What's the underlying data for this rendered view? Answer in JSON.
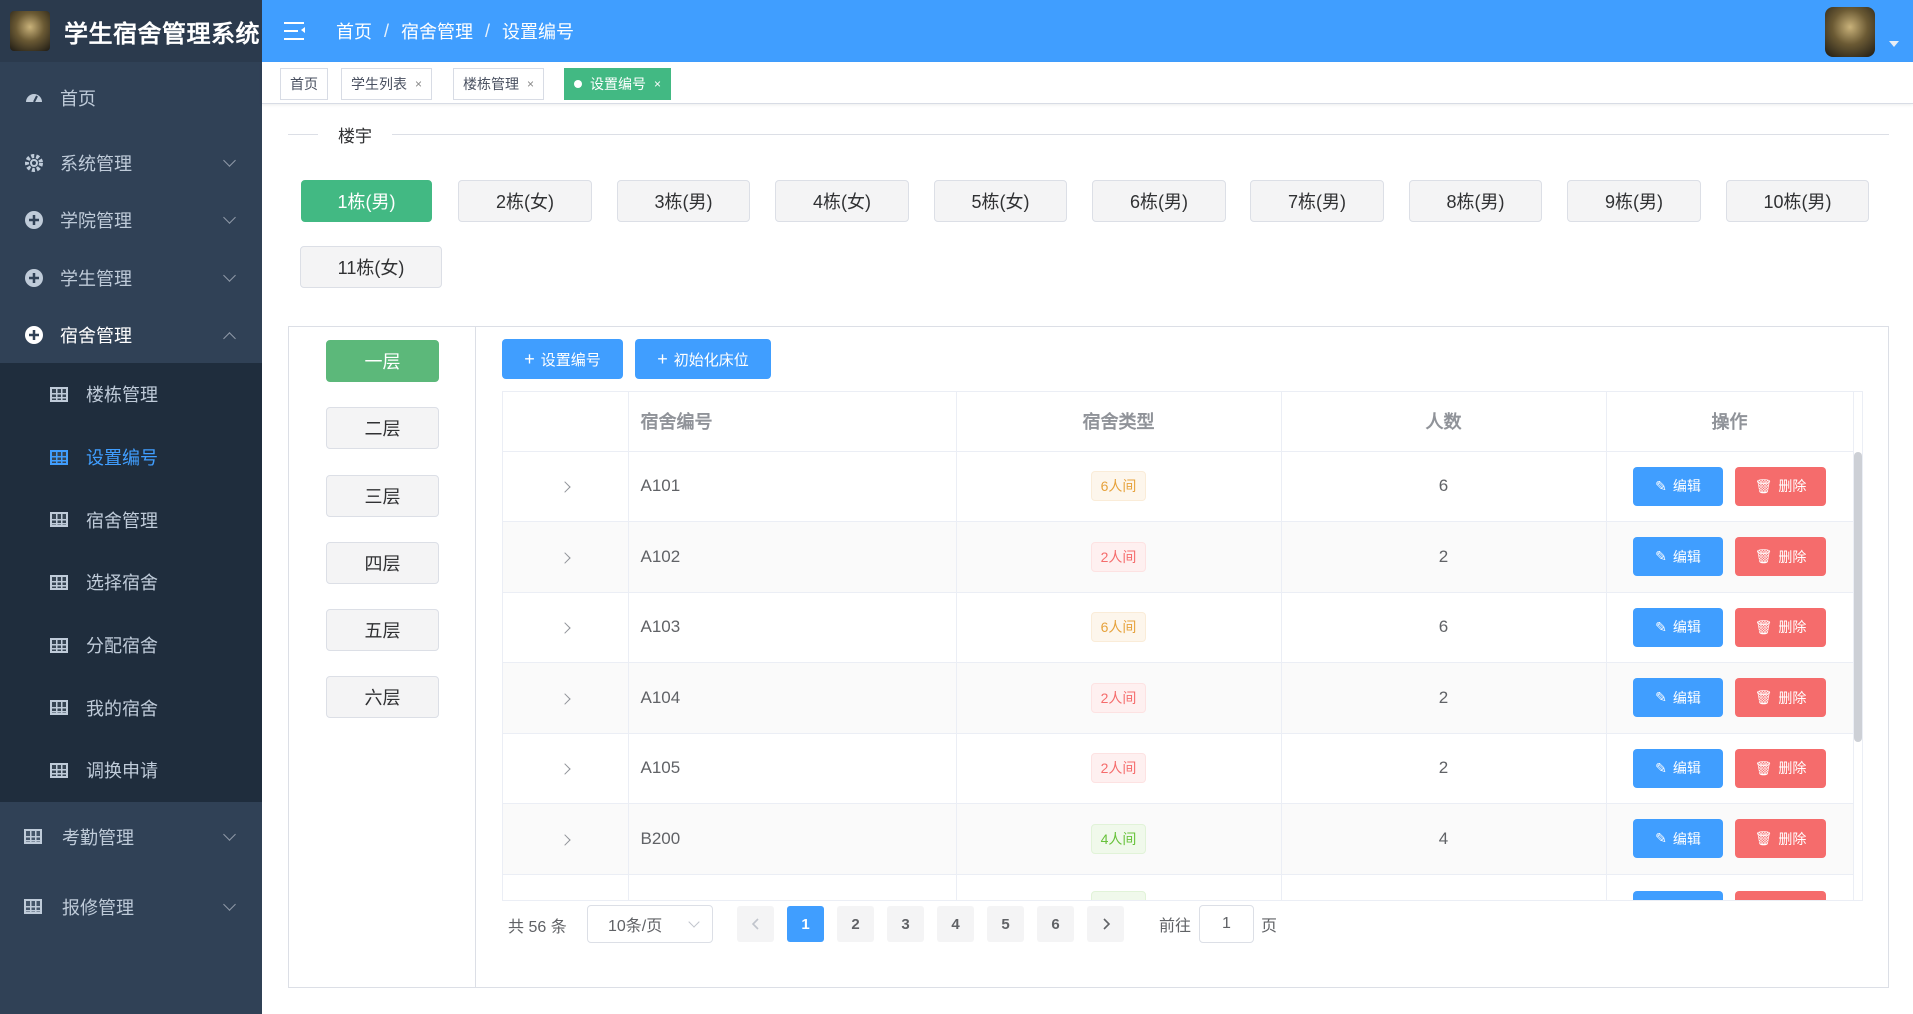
{
  "app": {
    "title": "学生宿舍管理系统"
  },
  "sidebar": {
    "items": [
      {
        "label": "首页",
        "icon": "dashboard-icon"
      },
      {
        "label": "系统管理",
        "icon": "gear-icon"
      },
      {
        "label": "学院管理",
        "icon": "circle-plus-icon"
      },
      {
        "label": "学生管理",
        "icon": "circle-plus-icon"
      },
      {
        "label": "宿舍管理",
        "icon": "circle-plus-icon",
        "open": true
      }
    ],
    "submenu": [
      {
        "label": "楼栋管理"
      },
      {
        "label": "设置编号",
        "active": true
      },
      {
        "label": "宿舍管理"
      },
      {
        "label": "选择宿舍"
      },
      {
        "label": "分配宿舍"
      },
      {
        "label": "我的宿舍"
      },
      {
        "label": "调换申请"
      }
    ],
    "bottom_items": [
      {
        "label": "考勤管理"
      },
      {
        "label": "报修管理"
      }
    ]
  },
  "breadcrumb": {
    "items": [
      "首页",
      "宿舍管理",
      "设置编号"
    ],
    "separator": "/"
  },
  "tags": [
    {
      "label": "首页"
    },
    {
      "label": "学生列表",
      "close": "×"
    },
    {
      "label": "楼栋管理",
      "close": "×"
    },
    {
      "label": "设置编号",
      "close": "×",
      "active": true
    }
  ],
  "building_section": {
    "label": "楼宇"
  },
  "buildings": [
    "1栋(男)",
    "2栋(女)",
    "3栋(男)",
    "4栋(女)",
    "5栋(女)",
    "6栋(男)",
    "7栋(男)",
    "8栋(男)",
    "9栋(男)",
    "10栋(男)",
    "11栋(女)"
  ],
  "floors": [
    "一层",
    "二层",
    "三层",
    "四层",
    "五层",
    "六层"
  ],
  "actions": {
    "set_number": "设置编号",
    "init_beds": "初始化床位"
  },
  "table": {
    "headers": [
      "",
      "宿舍编号",
      "宿舍类型",
      "人数",
      "操作"
    ],
    "rows": [
      {
        "code": "A101",
        "type": "6人间",
        "type_style": "warning",
        "count": "6"
      },
      {
        "code": "A102",
        "type": "2人间",
        "type_style": "danger",
        "count": "2"
      },
      {
        "code": "A103",
        "type": "6人间",
        "type_style": "warning",
        "count": "6"
      },
      {
        "code": "A104",
        "type": "2人间",
        "type_style": "danger",
        "count": "2"
      },
      {
        "code": "A105",
        "type": "2人间",
        "type_style": "danger",
        "count": "2"
      },
      {
        "code": "B200",
        "type": "4人间",
        "type_style": "success",
        "count": "4"
      }
    ],
    "edit_label": "编辑",
    "delete_label": "删除"
  },
  "pagination": {
    "total_text": "共 56 条",
    "page_size": "10条/页",
    "pages": [
      "1",
      "2",
      "3",
      "4",
      "5",
      "6"
    ],
    "current": "1",
    "goto_prefix": "前往",
    "goto_value": "1",
    "goto_suffix": "页"
  },
  "colors": {
    "sidebar": "#304156",
    "navbar": "#409eff",
    "active_green": "#42b983",
    "danger": "#f56c6c"
  }
}
